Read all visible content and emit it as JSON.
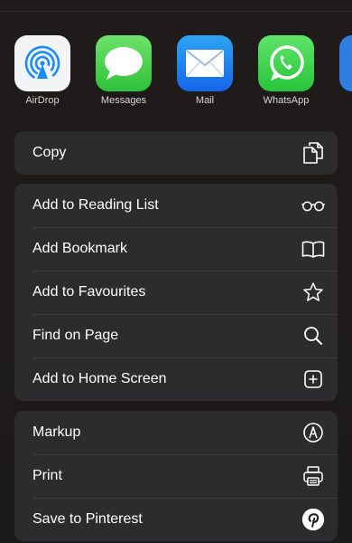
{
  "apps": [
    {
      "label": "AirDrop",
      "icon": "airdrop-icon"
    },
    {
      "label": "Messages",
      "icon": "messages-icon"
    },
    {
      "label": "Mail",
      "icon": "mail-icon"
    },
    {
      "label": "WhatsApp",
      "icon": "whatsapp-icon"
    }
  ],
  "actions": {
    "group1": [
      {
        "label": "Copy",
        "icon": "copy-icon"
      }
    ],
    "group2": [
      {
        "label": "Add to Reading List",
        "icon": "glasses-icon"
      },
      {
        "label": "Add Bookmark",
        "icon": "book-icon"
      },
      {
        "label": "Add to Favourites",
        "icon": "star-icon"
      },
      {
        "label": "Find on Page",
        "icon": "search-icon"
      },
      {
        "label": "Add to Home Screen",
        "icon": "plus-square-icon"
      }
    ],
    "group3": [
      {
        "label": "Markup",
        "icon": "markup-pen-icon"
      },
      {
        "label": "Print",
        "icon": "printer-icon"
      },
      {
        "label": "Save to Pinterest",
        "icon": "pinterest-icon"
      }
    ]
  },
  "colors": {
    "background": "#1e1a1a",
    "group_background": "#2c2c2e",
    "separator": "#3a3a3c",
    "mail_blue": "#1666e9",
    "messages_green": "#2fc13a",
    "airdrop_blue": "#1a8cff"
  }
}
